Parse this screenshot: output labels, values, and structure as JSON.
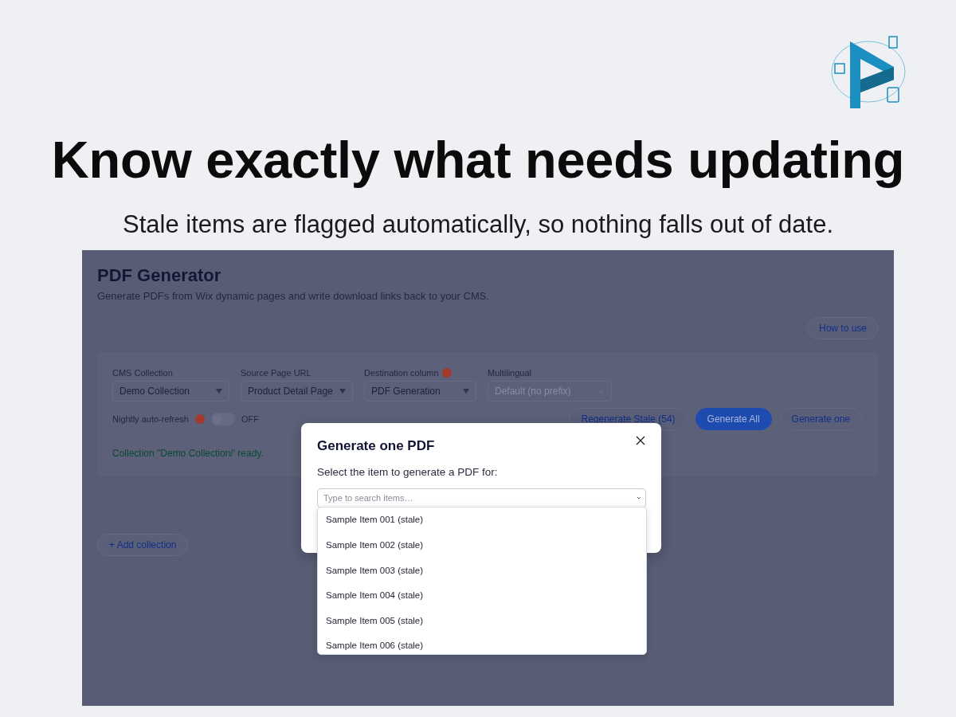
{
  "headline": "Know exactly what needs updating",
  "subheadline": "Stale items are flagged automatically, so nothing falls out of date.",
  "app": {
    "title": "PDF Generator",
    "subtitle": "Generate PDFs from Wix dynamic pages and write download links back to your CMS.",
    "help_button": "How to use",
    "fields": [
      {
        "label": "CMS Collection",
        "value": "Demo Collection",
        "warning": false,
        "disabled": false
      },
      {
        "label": "Source Page URL",
        "value": "Product Detail Page",
        "warning": false,
        "disabled": false
      },
      {
        "label": "Destination column",
        "value": "PDF Generation",
        "warning": true,
        "disabled": false
      },
      {
        "label": "Multilingual",
        "value": "Default (no prefix)",
        "warning": false,
        "disabled": true
      }
    ],
    "auto_refresh": {
      "label": "Nightly auto-refresh",
      "warning": true,
      "on": false,
      "state_text": "OFF"
    },
    "actions": [
      {
        "label": "Regenerate Stale (54)",
        "kind": "outline"
      },
      {
        "label": "Generate All",
        "kind": "primary"
      },
      {
        "label": "Generate one",
        "kind": "outline"
      }
    ],
    "status": "Collection \"Demo Collection/' ready.",
    "add_button": "+ Add collection"
  },
  "dialog": {
    "title": "Generate one PDF",
    "prompt": "Select the item to generate a PDF for:",
    "search": {
      "placeholder": "Type to search items…"
    },
    "options": [
      "Sample Item 001 (stale)",
      "Sample Item 002 (stale)",
      "Sample Item 003 (stale)",
      "Sample Item 004 (stale)",
      "Sample Item 005 (stale)",
      "Sample Item 006 (stale)"
    ]
  }
}
